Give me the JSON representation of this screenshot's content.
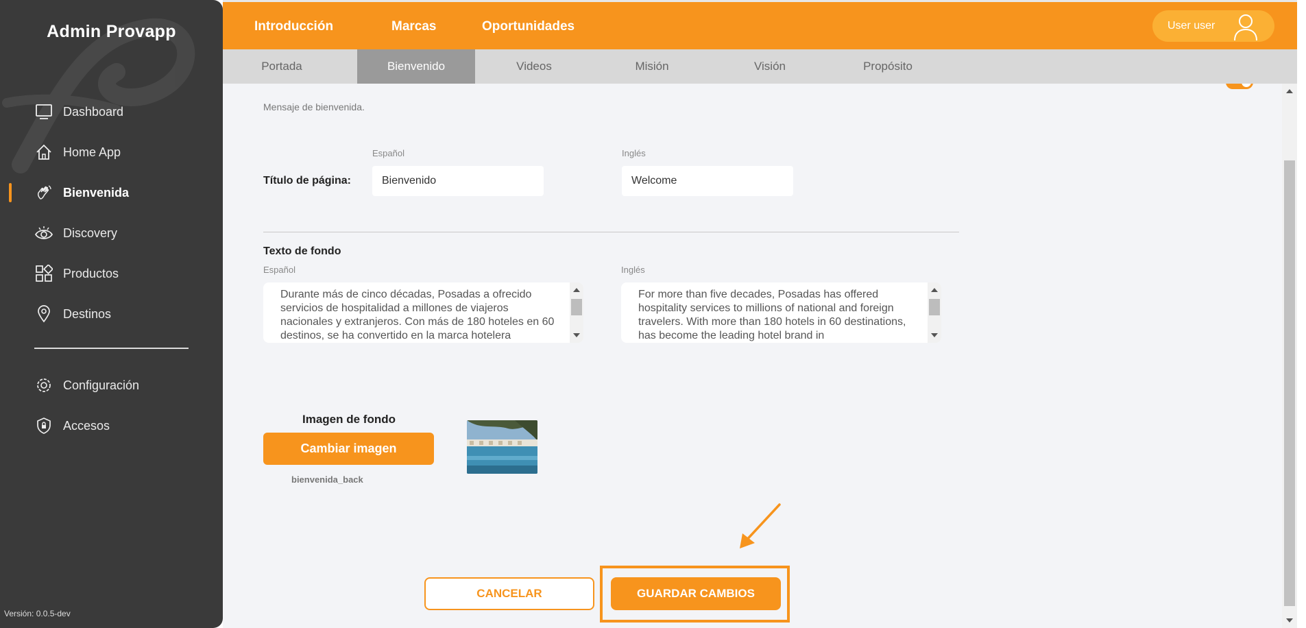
{
  "app": {
    "brand": "Admin Provapp",
    "version": "Versión: 0.0.5-dev"
  },
  "sidebar": {
    "items": [
      {
        "label": "Dashboard",
        "icon": "monitor-icon"
      },
      {
        "label": "Home App",
        "icon": "home-icon"
      },
      {
        "label": "Bienvenida",
        "icon": "wave-hand-icon",
        "active": true
      },
      {
        "label": "Discovery",
        "icon": "eye-icon"
      },
      {
        "label": "Productos",
        "icon": "grid-icon"
      },
      {
        "label": "Destinos",
        "icon": "location-pin-icon"
      },
      {
        "label": "Configuración",
        "icon": "gear-icon"
      },
      {
        "label": "Accesos",
        "icon": "shield-lock-icon"
      }
    ]
  },
  "topnav": {
    "items": [
      "Introducción",
      "Marcas",
      "Oportunidades"
    ],
    "user": "User user"
  },
  "subtabs": {
    "items": [
      "Portada",
      "Bienvenido",
      "Videos",
      "Misión",
      "Visión",
      "Propósito"
    ],
    "active": "Bienvenido"
  },
  "form": {
    "intro": "Mensaje de bienvenida.",
    "page_title_label": "Título de página:",
    "lang_es": "Español",
    "lang_en": "Inglés",
    "title_es": "Bienvenido",
    "title_en": "Welcome",
    "background_text_label": "Texto de fondo",
    "bg_text_es": "Durante más de cinco décadas, Posadas a ofrecido servicios de hospitalidad a millones de viajeros nacionales y extranjeros. Con más de 180 hoteles en 60 destinos, se ha convertido en la marca hotelera",
    "bg_text_en": "For more than five decades, Posadas has offered hospitality services to millions of national and foreign travelers. With more than 180 hotels in 60 destinations, has become the leading hotel brand in",
    "image_title": "Imagen de fondo",
    "change_image": "Cambiar imagen",
    "filename": "bienvenida_back"
  },
  "actions": {
    "cancel": "CANCELAR",
    "save": "GUARDAR CAMBIOS"
  },
  "colors": {
    "accent": "#f7941d",
    "sidebar": "#3a3a3a",
    "content_bg": "#f3f4f7"
  }
}
